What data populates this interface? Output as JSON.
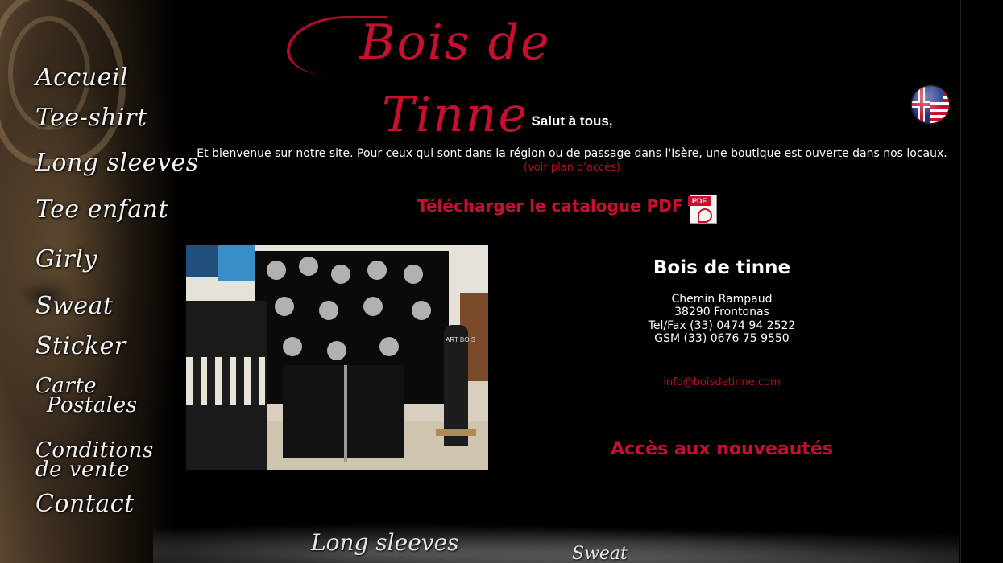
{
  "logo": {
    "text": "Bois de Tinne"
  },
  "nav": {
    "accueil": "Accueil",
    "tee_shirt": "Tee-shirt",
    "long_sleeves": "Long sleeves",
    "tee_enfant": "Tee enfant",
    "girly": "Girly",
    "sweat": "Sweat",
    "sticker": "Sticker",
    "carte_line1": "Carte",
    "carte_line2": "Postales",
    "conditions_line1": "Conditions",
    "conditions_line2": "de vente",
    "contact": "Contact"
  },
  "intro": {
    "greeting": "Salut à tous,",
    "welcome": "Et bienvenue sur notre site. Pour ceux qui sont dans la région ou de passage dans l'Isère, une boutique est ouverte dans nos locaux.",
    "map_link": "(voir plan d'accès)"
  },
  "catalog": {
    "label": "Télécharger le catalogue PDF",
    "badge": "PDF"
  },
  "contact": {
    "name": "Bois de tinne",
    "street": "Chemin Rampaud",
    "city": "38290 Frontonas",
    "tel": "Tel/Fax (33) 0474 94 2522",
    "gsm": "GSM (33) 0676 75 9550",
    "email": "info@boisdetinne.com"
  },
  "news_link": "Accès aux nouveautés",
  "banner": {
    "text1": "Long sleeves",
    "text2": "Sweat"
  },
  "photo_text": "ART BOIS",
  "colors": {
    "accent_red": "#c8102e",
    "link_red": "#b30f1c",
    "background": "#000000"
  }
}
